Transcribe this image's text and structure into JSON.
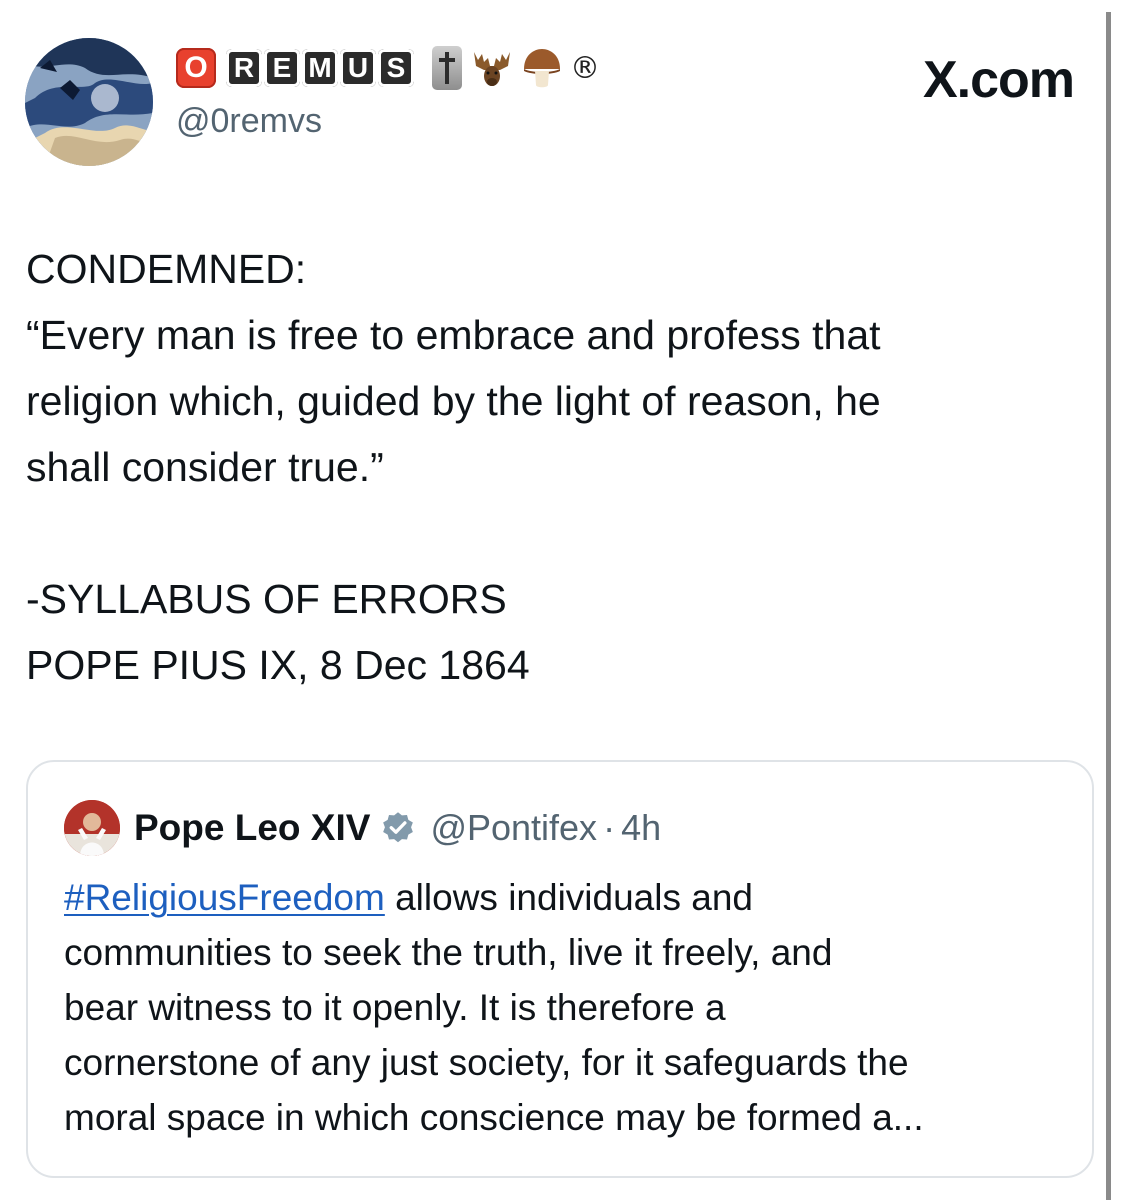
{
  "author": {
    "display_name_prefix": "O",
    "display_name_letters": [
      "R",
      "E",
      "M",
      "U",
      "S"
    ],
    "display_name_emoji": [
      "cross-icon",
      "moose-icon",
      "mushroom-icon"
    ],
    "registered_mark": "®",
    "handle": "@0remvs"
  },
  "site_label": "X.com",
  "tweet": {
    "line1": "CONDEMNED:",
    "quote": "“Every man is free to embrace and profess that\nreligion which, guided by the light of reason, he\nshall consider true.”",
    "source1": "-SYLLABUS OF ERRORS",
    "source2": "POPE PIUS IX, 8 Dec 1864"
  },
  "quoted_tweet": {
    "name": "Pope Leo XIV",
    "handle": "@Pontifex",
    "separator": "·",
    "time": "4h",
    "hashtag": "#ReligiousFreedom",
    "text_lines": [
      " allows individuals and",
      "communities to seek the truth, live it freely, and",
      "bear witness to it openly. It is therefore a",
      "cornerstone of any just society, for it safeguards the",
      "moral space in which conscience may be formed a..."
    ]
  },
  "colors": {
    "text": "#0f1419",
    "muted": "#536471",
    "link": "#1d5fbf",
    "badge_red": "#e8412e",
    "verified_gray": "#829aab"
  }
}
